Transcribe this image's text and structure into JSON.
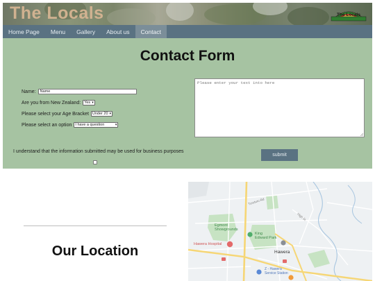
{
  "site": {
    "title": "The Locals",
    "logo_text": "The Locals"
  },
  "nav": {
    "items": [
      {
        "label": "Home Page"
      },
      {
        "label": "Menu"
      },
      {
        "label": "Gallery"
      },
      {
        "label": "About us"
      },
      {
        "label": "Contact",
        "active": true
      }
    ]
  },
  "contact": {
    "title": "Contact Form",
    "name_label": "Name:",
    "name_value": "Name",
    "nz_label": "Are you from New Zealand:",
    "nz_value": "Yes",
    "age_label": "Please select your Age Bracket",
    "age_value": "Under 20",
    "option_label": "Please select an option",
    "option_value": "I have a question",
    "message_placeholder": "Please enter your text into here",
    "consent_text": "I understand that the information submitted may be used for business purposes",
    "submit_label": "submit"
  },
  "location": {
    "title": "Our Location"
  },
  "map": {
    "labels": {
      "cemetery": "Egmont\nShowgrounds",
      "park": "King\nEdward Park",
      "hospital": "Hawera Hospital",
      "town": "Hawera",
      "station": "Z - Hawera\nService Station",
      "road1": "Turuturu Rd",
      "road2": "High St"
    }
  },
  "colors": {
    "nav_bg": "#5a7282",
    "nav_active": "#7b8e99",
    "form_bg": "#a6c3a2",
    "submit_bg": "#5a7282",
    "title_text": "#d8b694"
  }
}
